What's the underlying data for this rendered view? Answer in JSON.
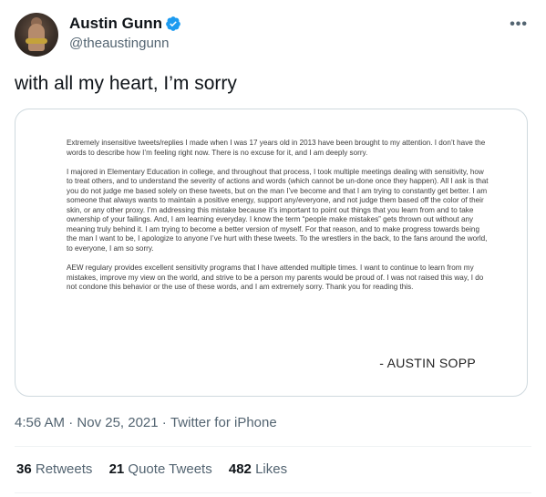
{
  "header": {
    "display_name": "Austin Gunn",
    "handle": "@theaustingunn",
    "verified_color": "#1d9bf0",
    "more_icon": "more-horizontal-icon"
  },
  "tweet": {
    "text": "with all my heart, I’m sorry"
  },
  "statement": {
    "paragraphs": [
      "Extremely insensitive tweets/replies I made when I was 17 years old in 2013 have been brought to my attention. I don’t have the words to describe how I’m feeling right now. There is no excuse for it, and I am deeply sorry.",
      "I majored in Elementary Education in college, and throughout that process, I took multiple meetings dealing with sensitivity, how to treat others, and to understand the severity of actions and words (which cannot be un-done once they happen). All I ask is that you do not judge me based solely on these tweets, but on the man I’ve become and that I am trying to constantly get better. I am someone that always wants to maintain a positive energy, support any/everyone, and not judge them based off the color of their skin, or any other proxy. I’m addressing this mistake because it’s important to point out things that you learn from and to take ownership of your failings. And, I am learning everyday. I know the term “people make mistakes” gets thrown out without any meaning truly behind it. I am trying to become a better version of myself. For that reason, and to make progress towards being the man I want to be, I apologize to anyone I’ve hurt with these tweets. To the wrestlers in the back, to the fans around the world, to everyone, I am so sorry.",
      "AEW regulary provides excellent sensitivity programs that I have attended multiple times. I want to continue to learn from my mistakes, improve my view on the world, and strive to be a person my parents would be proud of. I was not raised this way, I do not condone this behavior or the use of these words, and I am extremely sorry. Thank you for reading this."
    ],
    "signature": "- AUSTIN SOPP"
  },
  "meta": {
    "time": "4:56 AM",
    "date": "Nov 25, 2021",
    "source": "Twitter for iPhone",
    "separator": "·"
  },
  "stats": {
    "retweets_count": "36",
    "retweets_label": "Retweets",
    "quotes_count": "21",
    "quotes_label": "Quote Tweets",
    "likes_count": "482",
    "likes_label": "Likes"
  }
}
